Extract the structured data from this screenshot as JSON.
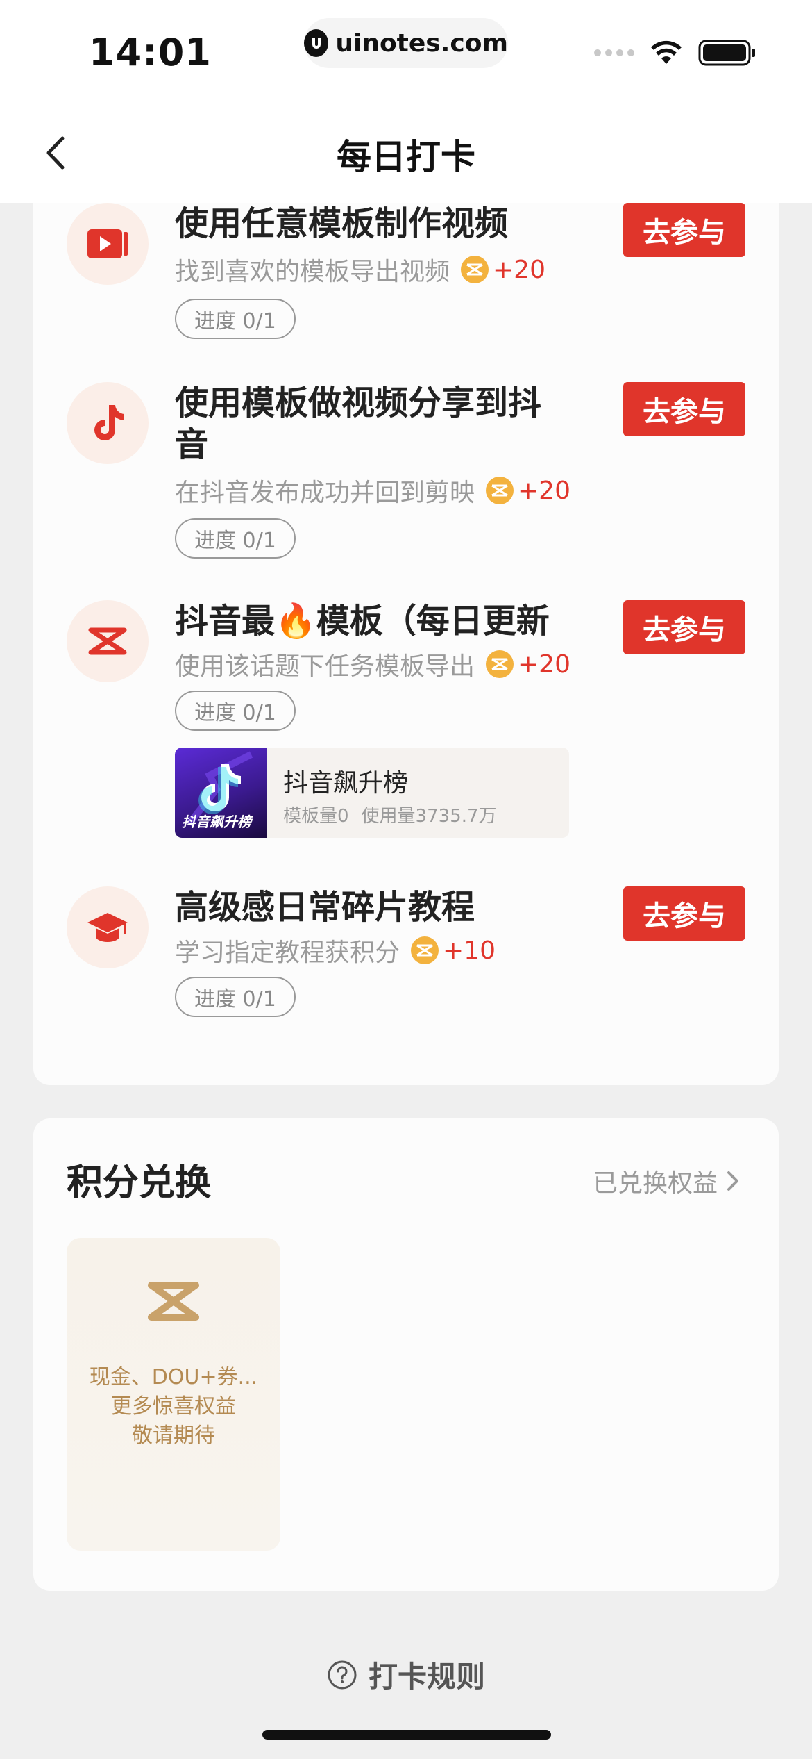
{
  "status_bar": {
    "time": "14:01",
    "url": "uinotes.com"
  },
  "nav": {
    "title": "每日打卡"
  },
  "tasks": [
    {
      "icon": "video-play-icon",
      "title": "使用任意模板制作视频",
      "subtitle": "找到喜欢的模板导出视频",
      "points": "+20",
      "progress": "进度 0/1",
      "button": "去参与"
    },
    {
      "icon": "tiktok-note-icon",
      "title": "使用模板做视频分享到抖音",
      "subtitle": "在抖音发布成功并回到剪映",
      "points": "+20",
      "progress": "进度 0/1",
      "button": "去参与"
    },
    {
      "icon": "capcut-logo-icon",
      "title": "抖音最🔥模板（每日更新",
      "subtitle": "使用该话题下任务模板导出",
      "points": "+20",
      "progress": "进度 0/1",
      "button": "去参与",
      "template": {
        "thumb_text": "抖音飙升榜",
        "name": "抖音飙升榜",
        "template_count": "模板量0",
        "usage_count": "使用量3735.7万"
      }
    },
    {
      "icon": "graduation-cap-icon",
      "title": "高级感日常碎片教程",
      "subtitle": "学习指定教程获积分",
      "points": "+10",
      "progress": "进度 0/1",
      "button": "去参与"
    }
  ],
  "exchange": {
    "title": "积分兑换",
    "link": "已兑换权益",
    "reward_line1": "现金、DOU+券...",
    "reward_line2": "更多惊喜权益",
    "reward_line3": "敬请期待"
  },
  "footer": {
    "rules": "打卡规则"
  },
  "colors": {
    "accent": "#e0352b",
    "coin": "#f3b23e",
    "reward_gold": "#b48a52"
  }
}
